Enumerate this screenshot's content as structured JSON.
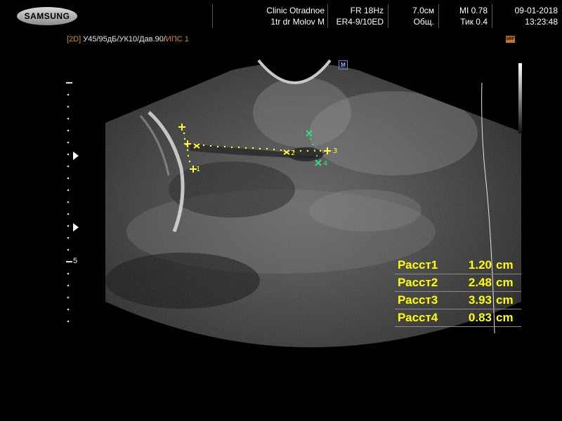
{
  "header": {
    "logo": "SAMSUNG",
    "clinic": "Clinic  Otradnoe",
    "doctor": "1tr dr Molov M",
    "frame_rate": "FR 18Hz",
    "probe": "ER4-9/10ED",
    "depth": "7.0см",
    "preset": "Общ.",
    "mi": "MI  0.78",
    "tib": "Тик 0.4",
    "date": "09-01-2018",
    "time": "13:23:48"
  },
  "params": {
    "mode": "[2D]",
    "settings": " У45/95дБ/УК10/Дав.90/",
    "ips": "ИПС 1"
  },
  "badges": {
    "srf": "SRF",
    "orientation": "M"
  },
  "depth_scale": {
    "label_5": "5"
  },
  "measurements": [
    {
      "label": "Расст1",
      "value": "1.20",
      "unit": "cm"
    },
    {
      "label": "Расст2",
      "value": "2.48",
      "unit": "cm"
    },
    {
      "label": "Расст3",
      "value": "3.93",
      "unit": "cm"
    },
    {
      "label": "Расст4",
      "value": "0.83",
      "unit": "cm"
    }
  ],
  "caliper_labels": [
    "1",
    "2",
    "3",
    "4"
  ],
  "colors": {
    "measure_text": "#ffff00",
    "caliper_yellow": "#ffff33",
    "caliper_green": "#33dd88",
    "params_orange": "#d98a2c"
  }
}
